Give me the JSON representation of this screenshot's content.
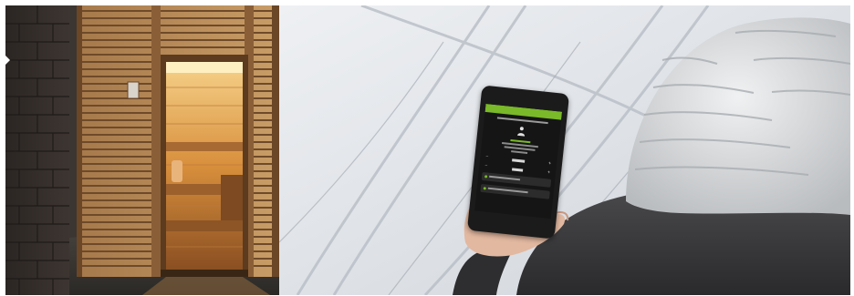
{
  "scene": {
    "left_panel": "sauna-entrance",
    "right_panel": "snowy-road-phone-user"
  },
  "colors": {
    "wood_light": "#c79a62",
    "wood_dark": "#7a5532",
    "sauna_glow": "#f0b25a",
    "brick": "#3a3330",
    "snow": "#e7eaee",
    "knit_hat": "#d6d8da",
    "app_accent": "#7ab929"
  }
}
